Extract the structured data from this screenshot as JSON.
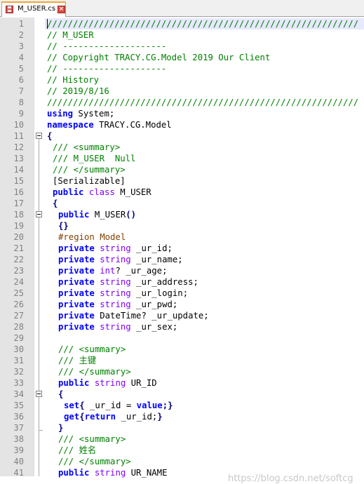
{
  "tab": {
    "title": "M_USER.cs",
    "close_glyph": "×"
  },
  "line_numbers": [
    "1",
    "2",
    "3",
    "4",
    "5",
    "6",
    "7",
    "8",
    "9",
    "10",
    "11",
    "12",
    "13",
    "14",
    "15",
    "16",
    "17",
    "18",
    "19",
    "20",
    "21",
    "22",
    "23",
    "24",
    "25",
    "26",
    "27",
    "28",
    "29",
    "30",
    "31",
    "32",
    "33",
    "34",
    "35",
    "36",
    "37",
    "38",
    "39",
    "40",
    "41"
  ],
  "code": [
    {
      "indent": 0,
      "tokens": [
        {
          "c": "c",
          "v": "////////////////////////////////////////////////////////////"
        }
      ]
    },
    {
      "indent": 0,
      "tokens": [
        {
          "c": "c",
          "v": "// M_USER"
        }
      ]
    },
    {
      "indent": 0,
      "tokens": [
        {
          "c": "c",
          "v": "// --------------------"
        }
      ]
    },
    {
      "indent": 0,
      "tokens": [
        {
          "c": "c",
          "v": "// Copyright TRACY.CG.Model 2019 Our Client"
        }
      ]
    },
    {
      "indent": 0,
      "tokens": [
        {
          "c": "c",
          "v": "// --------------------"
        }
      ]
    },
    {
      "indent": 0,
      "tokens": [
        {
          "c": "c",
          "v": "// History"
        }
      ]
    },
    {
      "indent": 0,
      "tokens": [
        {
          "c": "c",
          "v": "// 2019/8/16"
        }
      ]
    },
    {
      "indent": 0,
      "tokens": [
        {
          "c": "c",
          "v": "////////////////////////////////////////////////////////////"
        }
      ]
    },
    {
      "indent": 0,
      "tokens": [
        {
          "c": "k",
          "v": "using"
        },
        {
          "c": "n",
          "v": " System;"
        }
      ]
    },
    {
      "indent": 0,
      "tokens": [
        {
          "c": "k",
          "v": "namespace"
        },
        {
          "c": "n",
          "v": " TRACY.CG.Model"
        }
      ]
    },
    {
      "indent": 0,
      "tokens": [
        {
          "c": "p",
          "v": "{"
        }
      ]
    },
    {
      "indent": 1,
      "tokens": [
        {
          "c": "c",
          "v": "/// <summary>"
        }
      ]
    },
    {
      "indent": 1,
      "tokens": [
        {
          "c": "c",
          "v": "/// M_USER  Null"
        }
      ]
    },
    {
      "indent": 1,
      "tokens": [
        {
          "c": "c",
          "v": "/// </summary>"
        }
      ]
    },
    {
      "indent": 1,
      "tokens": [
        {
          "c": "n",
          "v": "[Serializable]"
        }
      ]
    },
    {
      "indent": 1,
      "tokens": [
        {
          "c": "k",
          "v": "public"
        },
        {
          "c": "n",
          "v": " "
        },
        {
          "c": "t",
          "v": "class"
        },
        {
          "c": "n",
          "v": " M_USER"
        }
      ]
    },
    {
      "indent": 1,
      "tokens": [
        {
          "c": "p",
          "v": "{"
        }
      ]
    },
    {
      "indent": 2,
      "tokens": [
        {
          "c": "k",
          "v": "public"
        },
        {
          "c": "n",
          "v": " M_USER"
        },
        {
          "c": "p",
          "v": "()"
        }
      ]
    },
    {
      "indent": 2,
      "tokens": [
        {
          "c": "p",
          "v": "{}"
        }
      ]
    },
    {
      "indent": 2,
      "tokens": [
        {
          "c": "r",
          "v": "#region Model"
        }
      ]
    },
    {
      "indent": 2,
      "tokens": [
        {
          "c": "k",
          "v": "private"
        },
        {
          "c": "n",
          "v": " "
        },
        {
          "c": "t",
          "v": "string"
        },
        {
          "c": "n",
          "v": " _ur_id;"
        }
      ]
    },
    {
      "indent": 2,
      "tokens": [
        {
          "c": "k",
          "v": "private"
        },
        {
          "c": "n",
          "v": " "
        },
        {
          "c": "t",
          "v": "string"
        },
        {
          "c": "n",
          "v": " _ur_name;"
        }
      ]
    },
    {
      "indent": 2,
      "tokens": [
        {
          "c": "k",
          "v": "private"
        },
        {
          "c": "n",
          "v": " "
        },
        {
          "c": "t",
          "v": "int"
        },
        {
          "c": "n",
          "v": "? _ur_age;"
        }
      ]
    },
    {
      "indent": 2,
      "tokens": [
        {
          "c": "k",
          "v": "private"
        },
        {
          "c": "n",
          "v": " "
        },
        {
          "c": "t",
          "v": "string"
        },
        {
          "c": "n",
          "v": " _ur_address;"
        }
      ]
    },
    {
      "indent": 2,
      "tokens": [
        {
          "c": "k",
          "v": "private"
        },
        {
          "c": "n",
          "v": " "
        },
        {
          "c": "t",
          "v": "string"
        },
        {
          "c": "n",
          "v": " _ur_login;"
        }
      ]
    },
    {
      "indent": 2,
      "tokens": [
        {
          "c": "k",
          "v": "private"
        },
        {
          "c": "n",
          "v": " "
        },
        {
          "c": "t",
          "v": "string"
        },
        {
          "c": "n",
          "v": " _ur_pwd;"
        }
      ]
    },
    {
      "indent": 2,
      "tokens": [
        {
          "c": "k",
          "v": "private"
        },
        {
          "c": "n",
          "v": " DateTime? _ur_update;"
        }
      ]
    },
    {
      "indent": 2,
      "tokens": [
        {
          "c": "k",
          "v": "private"
        },
        {
          "c": "n",
          "v": " "
        },
        {
          "c": "t",
          "v": "string"
        },
        {
          "c": "n",
          "v": " _ur_sex;"
        }
      ]
    },
    {
      "indent": 0,
      "tokens": []
    },
    {
      "indent": 2,
      "tokens": [
        {
          "c": "c",
          "v": "/// <summary>"
        }
      ]
    },
    {
      "indent": 2,
      "tokens": [
        {
          "c": "c",
          "v": "/// 主键"
        }
      ]
    },
    {
      "indent": 2,
      "tokens": [
        {
          "c": "c",
          "v": "/// </summary>"
        }
      ]
    },
    {
      "indent": 2,
      "tokens": [
        {
          "c": "k",
          "v": "public"
        },
        {
          "c": "n",
          "v": " "
        },
        {
          "c": "t",
          "v": "string"
        },
        {
          "c": "n",
          "v": " UR_ID"
        }
      ]
    },
    {
      "indent": 2,
      "tokens": [
        {
          "c": "p",
          "v": "{"
        }
      ]
    },
    {
      "indent": 3,
      "tokens": [
        {
          "c": "k",
          "v": "set"
        },
        {
          "c": "p",
          "v": "{"
        },
        {
          "c": "n",
          "v": " _ur_id = "
        },
        {
          "c": "k",
          "v": "value"
        },
        {
          "c": "p",
          "v": ";}"
        }
      ]
    },
    {
      "indent": 3,
      "tokens": [
        {
          "c": "k",
          "v": "get"
        },
        {
          "c": "p",
          "v": "{"
        },
        {
          "c": "k",
          "v": "return"
        },
        {
          "c": "n",
          "v": " _ur_id;"
        },
        {
          "c": "p",
          "v": "}"
        }
      ]
    },
    {
      "indent": 2,
      "tokens": [
        {
          "c": "p",
          "v": "}"
        }
      ]
    },
    {
      "indent": 2,
      "tokens": [
        {
          "c": "c",
          "v": "/// <summary>"
        }
      ]
    },
    {
      "indent": 2,
      "tokens": [
        {
          "c": "c",
          "v": "/// 姓名"
        }
      ]
    },
    {
      "indent": 2,
      "tokens": [
        {
          "c": "c",
          "v": "/// </summary>"
        }
      ]
    },
    {
      "indent": 2,
      "tokens": [
        {
          "c": "k",
          "v": "public"
        },
        {
          "c": "n",
          "v": " "
        },
        {
          "c": "t",
          "v": "string"
        },
        {
          "c": "n",
          "v": " UR_NAME"
        }
      ]
    }
  ],
  "watermark": "https://blog.csdn.net/softcg"
}
